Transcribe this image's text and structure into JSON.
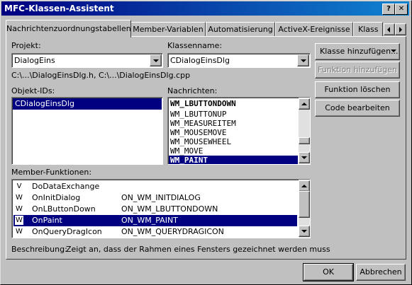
{
  "window": {
    "title": "MFC-Klassen-Assistent",
    "help_glyph": "?",
    "close_glyph": "✕"
  },
  "tabs": [
    {
      "label": "Nachrichtenzuordnungstabellen",
      "active": true
    },
    {
      "label": "Member-Variablen"
    },
    {
      "label": "Automatisierung"
    },
    {
      "label": "ActiveX-Ereignisse"
    },
    {
      "label": "Klass"
    }
  ],
  "projekt": {
    "label": "Projekt:",
    "value": "DialogEins"
  },
  "klassenname": {
    "label": "Klassenname:",
    "value": "CDialogEinsDlg"
  },
  "files_path": "C:\\...\\DialogEinsDlg.h, C:\\...\\DialogEinsDlg.cpp",
  "objekt_ids": {
    "label": "Objekt-IDs:",
    "items": [
      "CDialogEinsDlg"
    ],
    "selected": 0
  },
  "nachrichten": {
    "label": "Nachrichten:",
    "items": [
      "WM_LBUTTONDOWN",
      "WM_LBUTTONUP",
      "WM_MEASUREITEM",
      "WM_MOUSEMOVE",
      "WM_MOUSEWHEEL",
      "WM_MOVE",
      "WM_PAINT"
    ],
    "bold": [
      "WM_LBUTTONDOWN",
      "WM_PAINT"
    ],
    "selected": 6
  },
  "member_funktionen": {
    "label": "Member-Funktionen:",
    "rows": [
      {
        "icon": "V",
        "name": "DoDataExchange",
        "map": ""
      },
      {
        "icon": "W",
        "name": "OnInitDialog",
        "map": "ON_WM_INITDIALOG"
      },
      {
        "icon": "W",
        "name": "OnLButtonDown",
        "map": "ON_WM_LBUTTONDOWN"
      },
      {
        "icon": "W",
        "name": "OnPaint",
        "map": "ON_WM_PAINT"
      },
      {
        "icon": "W",
        "name": "OnQueryDragIcon",
        "map": "ON_WM_QUERYDRAGICON"
      }
    ],
    "selected": 3
  },
  "buttons": {
    "klasse_hinzufuegen": "Klasse hinzufügen...",
    "funktion_hinzufuegen": "Funktion hinzufügen",
    "funktion_loeschen": "Funktion löschen",
    "code_bearbeiten": "Code bearbeiten",
    "ok": "OK",
    "abbrechen": "Abbrechen"
  },
  "beschreibung": {
    "label": "Beschreibung:",
    "text": "Zeigt an, dass der Rahmen eines Fensters gezeichnet werden muss"
  }
}
